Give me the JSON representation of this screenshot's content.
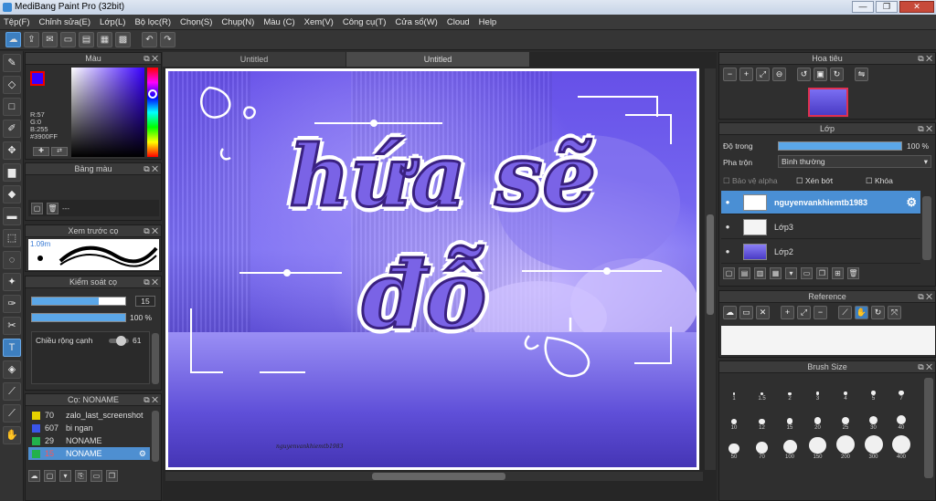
{
  "window": {
    "title": "MediBang Paint Pro (32bit)",
    "min": "0",
    "max": "1",
    "close": "r"
  },
  "menu": [
    "Tệp(F)",
    "Chỉnh sửa(E)",
    "Lớp(L)",
    "Bộ lọc(R)",
    "Chọn(S)",
    "Chụp(N)",
    "Màu (C)",
    "Xem(V)",
    "Công cụ(T)",
    "Cửa sổ(W)",
    "Cloud",
    "Help"
  ],
  "toolbar_icons": [
    "cloud-icon",
    "export-icon",
    "chat-icon",
    "layer-window-icon",
    "document-icon",
    "grid-icon",
    "tiles-icon",
    "undo-icon",
    "redo-icon"
  ],
  "tools": [
    "brush-icon",
    "eraser-icon",
    "rectangle-icon",
    "pen-icon",
    "move-icon",
    "fill-icon",
    "bucket-icon",
    "gradient-icon",
    "select-rect-icon",
    "lasso-icon",
    "magic-wand-icon",
    "select-pen-icon",
    "select-eraser-icon",
    "text-icon",
    "divide-icon",
    "eyedropper-icon",
    "eyedropper2-icon",
    "hand-icon"
  ],
  "color_panel": {
    "title": "Màu",
    "r": "R:57",
    "g": "G:0",
    "b": "B:255",
    "hex": "#3900FF",
    "primary": "#3900ff"
  },
  "palette_panel": {
    "title": "Bảng màu",
    "value": "---"
  },
  "brush_preview": {
    "title": "Xem trước cọ",
    "size": "1.09m"
  },
  "brush_control": {
    "title": "Kiểm soát cọ",
    "size_value": "15",
    "opacity_value": "100 %",
    "edge_label": "Chiều rộng cạnh",
    "edge_value": "61",
    "size_fill": 0.72,
    "opacity_fill": 1.0
  },
  "brush_list": {
    "title": "Cọ: NONAME",
    "items": [
      {
        "num": "70",
        "name": "zalo_last_screenshot",
        "color": "#e6d200"
      },
      {
        "num": "607",
        "name": "bi ngan",
        "color": "#3a55e8"
      },
      {
        "num": "29",
        "name": "NONAME",
        "color": "#22b14c"
      },
      {
        "num": "15",
        "name": "NONAME",
        "color": "#22b14c"
      }
    ]
  },
  "doc_tabs": [
    "Untitled",
    "Untitled"
  ],
  "artwork": {
    "line1": "hứa sẽ",
    "line2": "đỗ",
    "watermark": "nguyenvankhiemtb1983"
  },
  "navigator": {
    "title": "Hoa tiêu"
  },
  "layer_panel": {
    "title": "Lớp",
    "opacity_label": "Độ trong",
    "opacity_value": "100 %",
    "blend_label": "Pha trộn",
    "blend_value": "Bình thường",
    "protect_alpha": "Bảo vệ alpha",
    "clipping": "Xén bớt",
    "lock": "Khóa",
    "layers": [
      "nguyenvankhiemtb1983",
      "Lớp3",
      "Lớp2"
    ]
  },
  "reference": {
    "title": "Reference"
  },
  "brush_size": {
    "title": "Brush Size",
    "sizes": [
      "1",
      "1.5",
      "2",
      "3",
      "4",
      "5",
      "7",
      "10",
      "12",
      "15",
      "20",
      "25",
      "30",
      "40",
      "50",
      "70",
      "100",
      "150",
      "200",
      "300",
      "400"
    ]
  }
}
